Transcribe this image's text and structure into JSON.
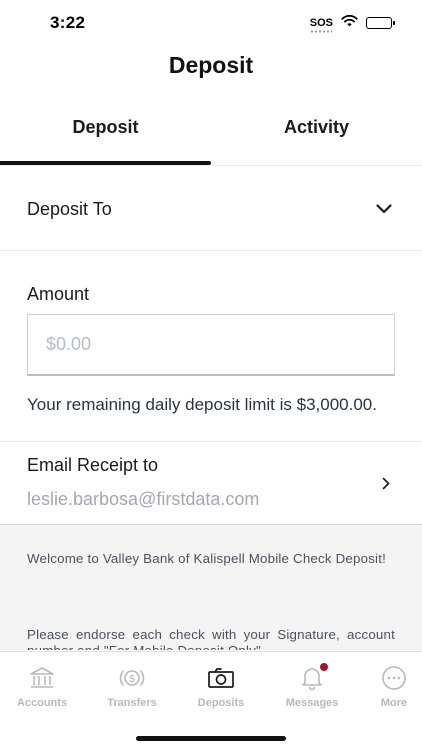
{
  "status_bar": {
    "time": "3:22",
    "carrier": "SOS"
  },
  "header": {
    "title": "Deposit"
  },
  "tabs": [
    {
      "label": "Deposit",
      "active": true
    },
    {
      "label": "Activity",
      "active": false
    }
  ],
  "deposit_to": {
    "label": "Deposit To",
    "icon": "chevron-down-icon"
  },
  "amount": {
    "label": "Amount",
    "value": "",
    "placeholder": "$0.00"
  },
  "limit_text": "Your remaining daily deposit limit is $3,000.00.",
  "email_receipt": {
    "label": "Email Receipt to",
    "value": "leslie.barbosa@firstdata.com",
    "icon": "chevron-right-icon"
  },
  "info": {
    "paragraph1": "Welcome to Valley Bank of Kalispell Mobile Check Deposit!",
    "paragraph2": "Please endorse each check with your Signature, account number and \"For Mobile Deposit Only\"."
  },
  "tab_bar": [
    {
      "label": "Accounts",
      "icon": "bank-icon",
      "active": false
    },
    {
      "label": "Transfers",
      "icon": "transfer-money-icon",
      "active": false
    },
    {
      "label": "Deposits",
      "icon": "camera-icon",
      "active": true
    },
    {
      "label": "Messages",
      "icon": "bell-icon",
      "active": false,
      "has_notification": true
    },
    {
      "label": "More",
      "icon": "more-dots-icon",
      "active": false
    }
  ],
  "colors": {
    "accent": "#111111",
    "inactive": "#b9b9b9",
    "notification": "#a3162b",
    "info_background": "#f4f4f4"
  }
}
